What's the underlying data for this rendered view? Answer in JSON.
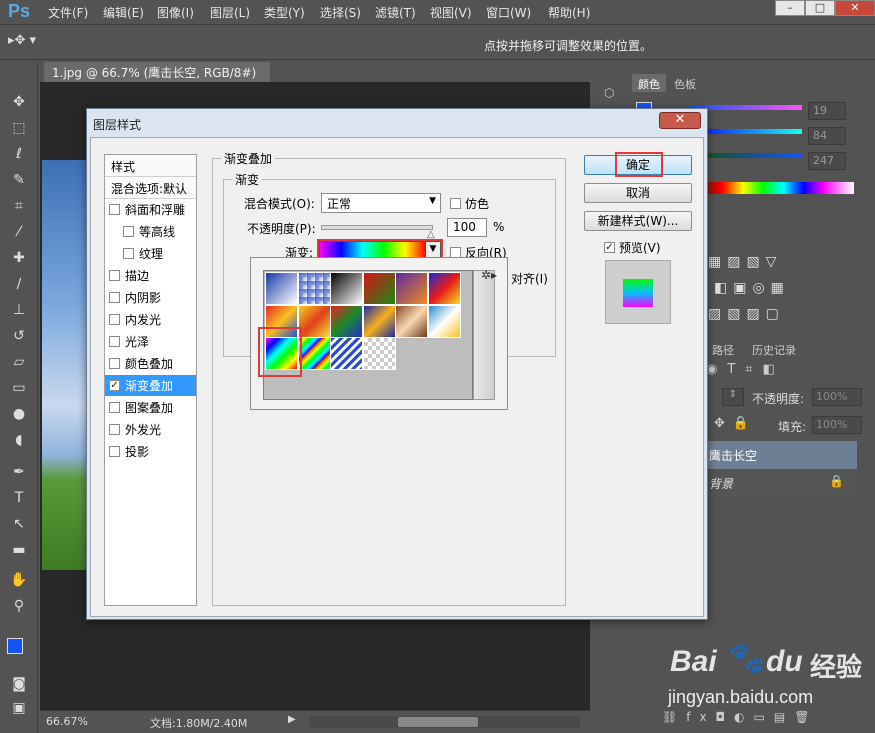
{
  "app": {
    "logo": "Ps",
    "menu": [
      "文件(F)",
      "编辑(E)",
      "图像(I)",
      "图层(L)",
      "类型(Y)",
      "选择(S)",
      "滤镜(T)",
      "视图(V)",
      "窗口(W)",
      "帮助(H)"
    ],
    "window_controls": [
      "–",
      "□",
      "✕"
    ]
  },
  "options_bar": {
    "hint": "点按并拖移可调整效果的位置。"
  },
  "document": {
    "tab_title": "1.jpg @ 66.7% (鹰击长空, RGB/8#) *",
    "tab_close": "×",
    "zoom": "66.67%",
    "doc_info": "文档:1.80M/2.40M"
  },
  "panels": {
    "color_tabs": [
      "颜色",
      "色板"
    ],
    "color_values": [
      "19",
      "84",
      "247"
    ],
    "paths_tab": "路径",
    "history_tab": "历史记录",
    "opacity_label": "不透明度:",
    "opacity_value": "100%",
    "fill_label": "填充:",
    "fill_value": "100%",
    "layer_active": "鹰击长空",
    "layer_background": "背景",
    "accent_color": "#1354f7"
  },
  "dialog": {
    "title": "图层样式",
    "close_label": "✕",
    "style_list": {
      "head": "样式",
      "blend_default": "混合选项:默认",
      "items": [
        {
          "label": "斜面和浮雕",
          "checked": false,
          "sub": false
        },
        {
          "label": "等高线",
          "checked": false,
          "sub": true
        },
        {
          "label": "纹理",
          "checked": false,
          "sub": true
        },
        {
          "label": "描边",
          "checked": false,
          "sub": false
        },
        {
          "label": "内阴影",
          "checked": false,
          "sub": false
        },
        {
          "label": "内发光",
          "checked": false,
          "sub": false
        },
        {
          "label": "光泽",
          "checked": false,
          "sub": false
        },
        {
          "label": "颜色叠加",
          "checked": false,
          "sub": false
        },
        {
          "label": "渐变叠加",
          "checked": true,
          "sub": false,
          "selected": true
        },
        {
          "label": "图案叠加",
          "checked": false,
          "sub": false
        },
        {
          "label": "外发光",
          "checked": false,
          "sub": false
        },
        {
          "label": "投影",
          "checked": false,
          "sub": false
        }
      ]
    },
    "gradient_overlay": {
      "group_title": "渐变叠加",
      "subgroup_title": "渐变",
      "blend_mode_label": "混合模式(O):",
      "blend_mode_value": "正常",
      "dither_label": "仿色",
      "opacity_label": "不透明度(P):",
      "opacity_value": "100",
      "opacity_unit": "%",
      "gradient_label": "渐变:",
      "reverse_label": "反向(R)",
      "align_label": "对齐(I)"
    },
    "buttons": {
      "ok": "确定",
      "cancel": "取消",
      "new_style": "新建样式(W)...",
      "preview": "预览(V)"
    }
  },
  "watermark": {
    "brand": "Bai",
    "brand2": "du",
    "suffix": "经验",
    "url": "jingyan.baidu.com"
  }
}
